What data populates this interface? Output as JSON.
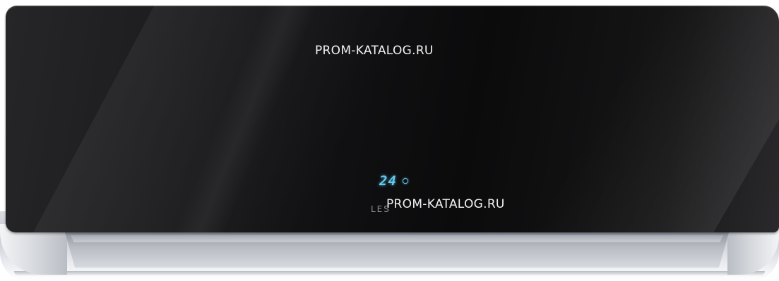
{
  "watermark": {
    "top_text": "PROM-KATALOG.RU",
    "bottom_text": "PROM-KATALOG.RU"
  },
  "display": {
    "temperature": "24",
    "indicator_icon": "mode-indicator-icon",
    "color": "#62c8ef"
  },
  "brand": {
    "text": "LES"
  },
  "colors": {
    "panel": "#0f0f10",
    "housing": "#c8ccd2",
    "display_led": "#62c8ef"
  }
}
